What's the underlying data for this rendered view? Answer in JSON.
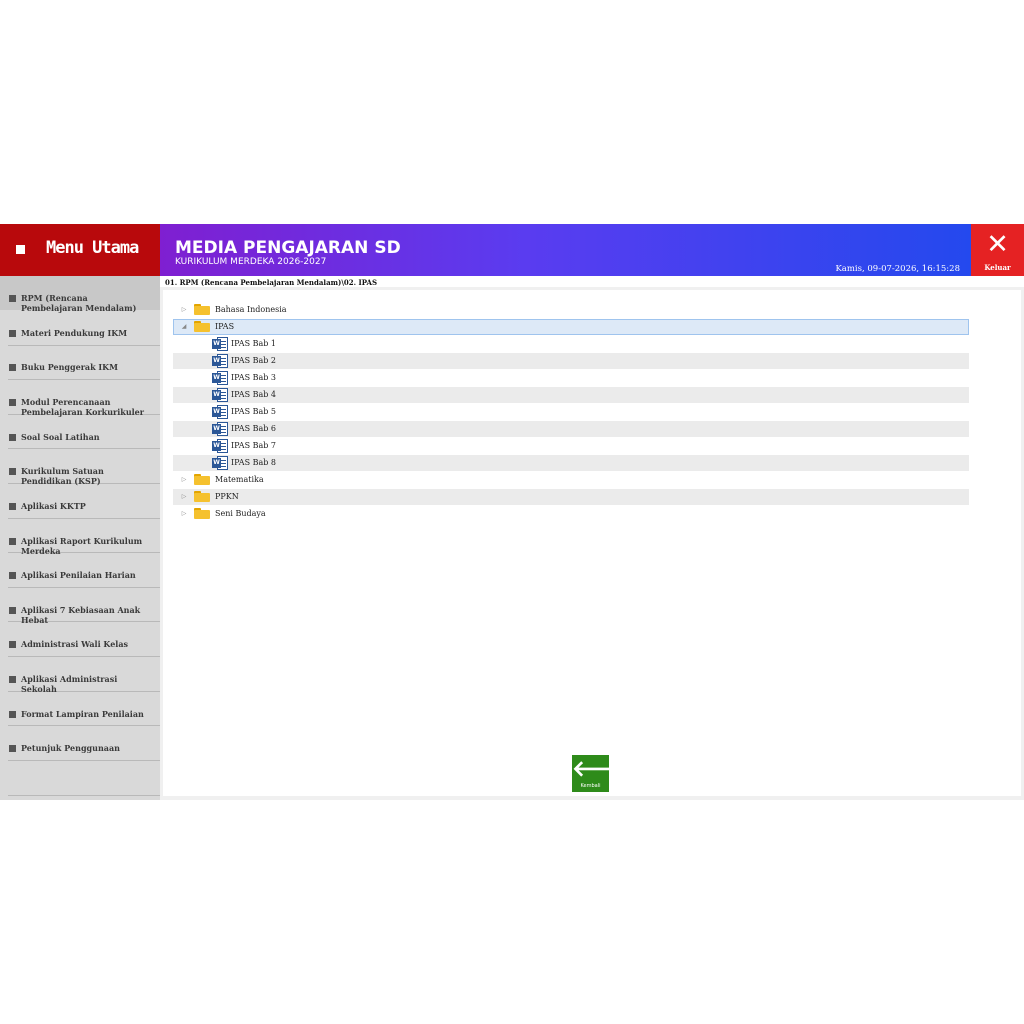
{
  "menu": {
    "title": "Menu Utama"
  },
  "header": {
    "title": "MEDIA PENGAJARAN SD",
    "subtitle": "KURIKULUM MERDEKA 2026-2027",
    "datetime": "Kamis, 09-07-2026, 16:15:28"
  },
  "exit": {
    "label": "Keluar",
    "icon": "close-icon"
  },
  "sidebar": {
    "items": [
      {
        "label": "RPM (Rencana Pembelajaran Mendalam)",
        "active": true
      },
      {
        "label": "Materi Pendukung IKM"
      },
      {
        "label": "Buku Penggerak  IKM"
      },
      {
        "label": "Modul Perencanaan Pembelajaran Korkurikuler"
      },
      {
        "label": "Soal Soal Latihan"
      },
      {
        "label": "Kurikulum Satuan Pendidikan (KSP)"
      },
      {
        "label": "Aplikasi KKTP"
      },
      {
        "label": "Aplikasi Raport Kurikulum Merdeka"
      },
      {
        "label": "Aplikasi Penilaian Harian"
      },
      {
        "label": "Aplikasi 7 Kebiasaan Anak Hebat"
      },
      {
        "label": "Administrasi Wali Kelas"
      },
      {
        "label": "Aplikasi Administrasi Sekolah"
      },
      {
        "label": "Format Lampiran Penilaian"
      },
      {
        "label": "Petunjuk Penggunaan"
      }
    ]
  },
  "path": "01. RPM (Rencana Pembelajaran Mendalam)\\02. IPAS",
  "tree": [
    {
      "label": "Bahasa Indonesia",
      "type": "folder",
      "expanded": false
    },
    {
      "label": "IPAS",
      "type": "folder",
      "expanded": true,
      "selected": true
    },
    {
      "label": "IPAS Bab 1",
      "type": "word"
    },
    {
      "label": "IPAS Bab 2",
      "type": "word"
    },
    {
      "label": "IPAS Bab 3",
      "type": "word"
    },
    {
      "label": "IPAS Bab 4",
      "type": "word"
    },
    {
      "label": "IPAS Bab 5",
      "type": "word"
    },
    {
      "label": "IPAS Bab 6",
      "type": "word"
    },
    {
      "label": "IPAS Bab 7",
      "type": "word"
    },
    {
      "label": "IPAS Bab 8",
      "type": "word"
    },
    {
      "label": "Matematika",
      "type": "folder",
      "expanded": false
    },
    {
      "label": "PPKN",
      "type": "folder",
      "expanded": false
    },
    {
      "label": "Seni Budaya",
      "type": "folder",
      "expanded": false
    }
  ],
  "back": {
    "label": "Kembali",
    "icon": "arrow-left-icon"
  },
  "colors": {
    "menu_bg": "#b8090c",
    "banner_start": "#7f1fd1",
    "banner_end": "#2449ee",
    "exit_bg": "#e52223",
    "back_bg": "#2e8b1a"
  }
}
